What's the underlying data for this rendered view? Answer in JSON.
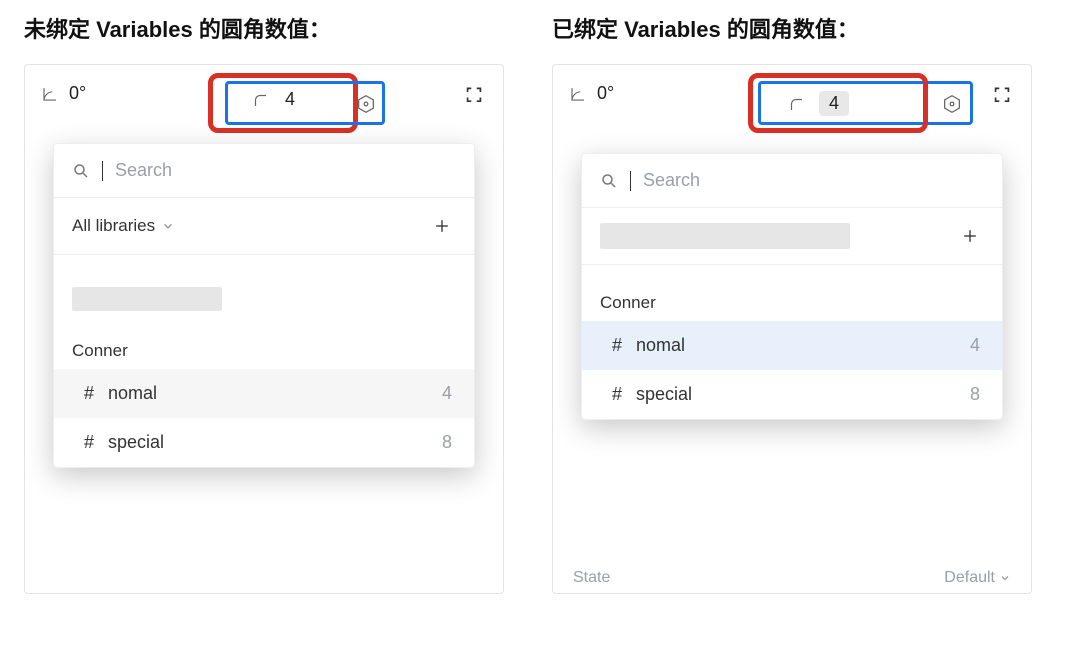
{
  "left": {
    "heading": "未绑定 Variables 的圆角数值：",
    "angle_value": "0°",
    "radius_value": "4",
    "search_placeholder": "Search",
    "libraries_label": "All libraries",
    "group_name": "Conner",
    "items": [
      {
        "name": "nomal",
        "value": "4"
      },
      {
        "name": "special",
        "value": "8"
      }
    ]
  },
  "right": {
    "heading": "已绑定 Variables 的圆角数值：",
    "angle_value": "0°",
    "radius_value": "4",
    "search_placeholder": "Search",
    "group_name": "Conner",
    "items": [
      {
        "name": "nomal",
        "value": "4",
        "active": true
      },
      {
        "name": "special",
        "value": "8",
        "active": false
      }
    ],
    "under": {
      "state_label": "State",
      "state_value": "Default"
    }
  }
}
